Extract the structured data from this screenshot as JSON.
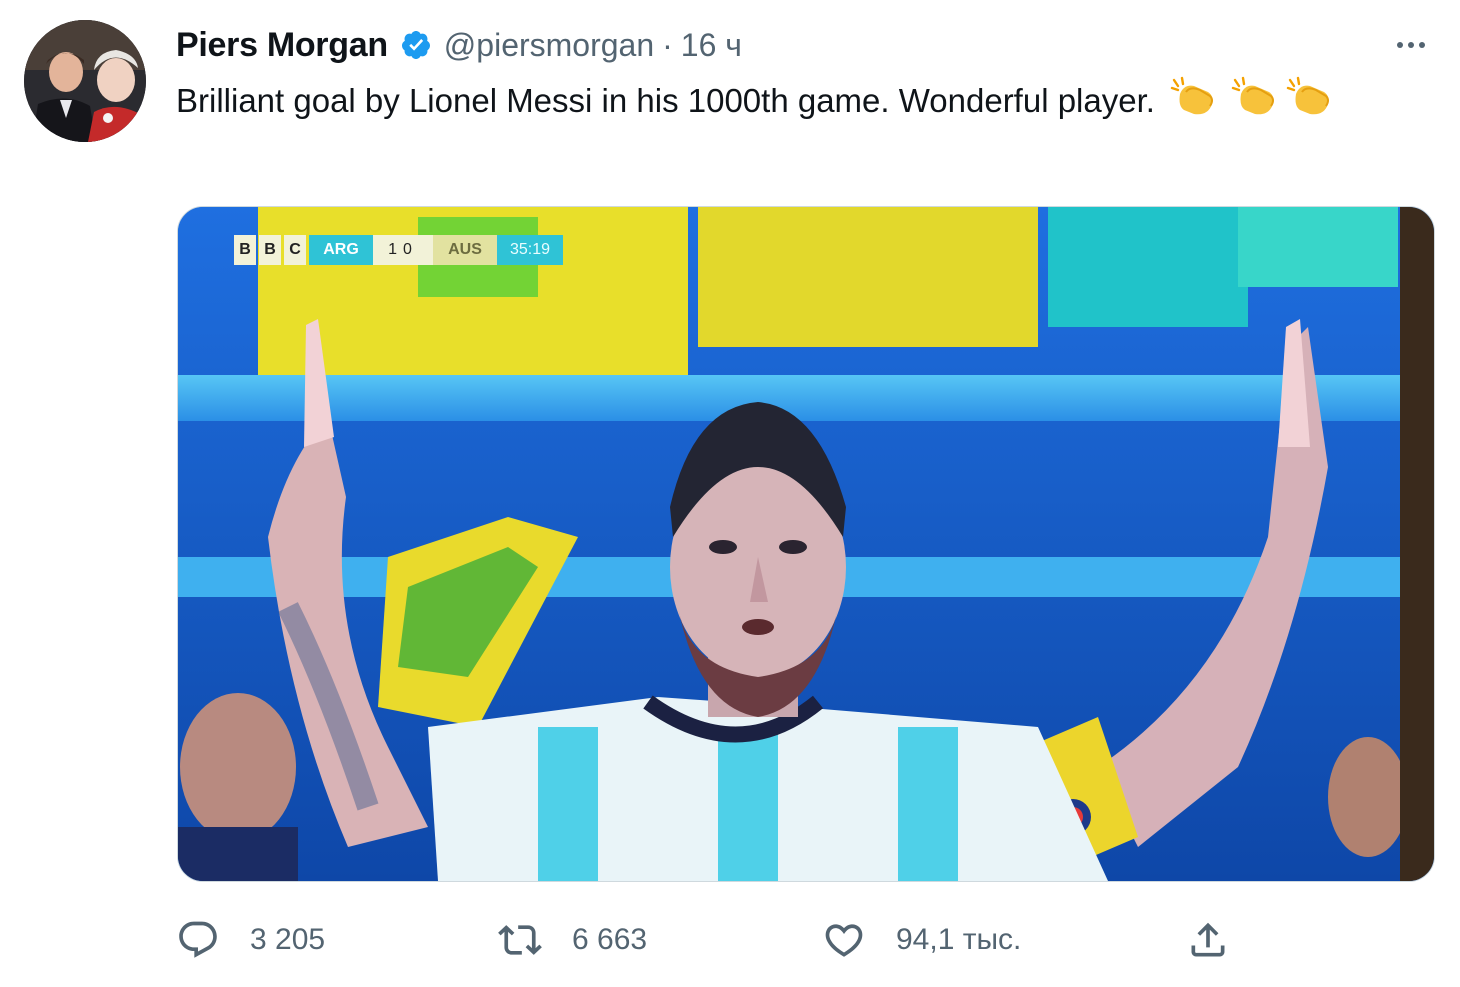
{
  "author": {
    "display_name": "Piers Morgan",
    "handle": "@piersmorgan",
    "separator": "·",
    "timestamp": "16 ч",
    "verified": true
  },
  "tweet": {
    "text": "Brilliant goal by Lionel Messi in his 1000th game. Wonderful player.",
    "emojis": [
      "clapping-hands",
      "clapping-hands",
      "clapping-hands"
    ]
  },
  "media": {
    "scorebug": {
      "broadcaster": [
        "B",
        "B",
        "C"
      ],
      "home_team": "ARG",
      "home_score": "1",
      "away_score": "0",
      "away_team": "AUS",
      "clock": "35:19"
    }
  },
  "actions": {
    "reply_count": "3 205",
    "retweet_count": "6 663",
    "like_count": "94,1 тыс.",
    "share_icon": "share-icon"
  },
  "colors": {
    "verified_blue": "#1d9bf0",
    "secondary_text": "#536471",
    "primary_text": "#0f1419"
  }
}
